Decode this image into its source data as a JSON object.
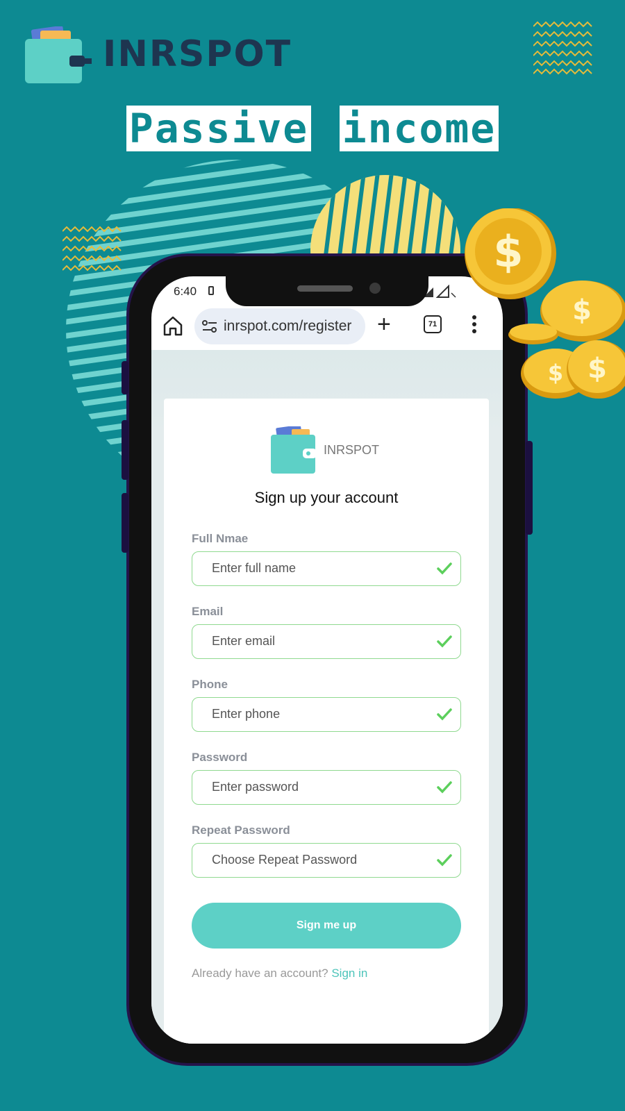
{
  "brand": {
    "name": "INRSPOT"
  },
  "banner": {
    "word1": "Passive",
    "word2": "income"
  },
  "status": {
    "time": "6:40"
  },
  "browser": {
    "url": "inrspot.com/register",
    "tabs_count": "71"
  },
  "card": {
    "brand": "INRSPOT",
    "title": "Sign up your account"
  },
  "form": {
    "fields": [
      {
        "label": "Full Nmae",
        "placeholder": "Enter full name"
      },
      {
        "label": "Email",
        "placeholder": "Enter email"
      },
      {
        "label": "Phone",
        "placeholder": "Enter phone"
      },
      {
        "label": "Password",
        "placeholder": "Enter password"
      },
      {
        "label": "Repeat Password",
        "placeholder": "Choose Repeat Password"
      }
    ],
    "submit_label": "Sign me up",
    "footer_text": "Already have an account?",
    "footer_link": "Sign in"
  },
  "colors": {
    "background": "#0d8a92",
    "accent": "#5dd0c6",
    "check": "#5ccf5c",
    "coin": "#f2b51a"
  }
}
